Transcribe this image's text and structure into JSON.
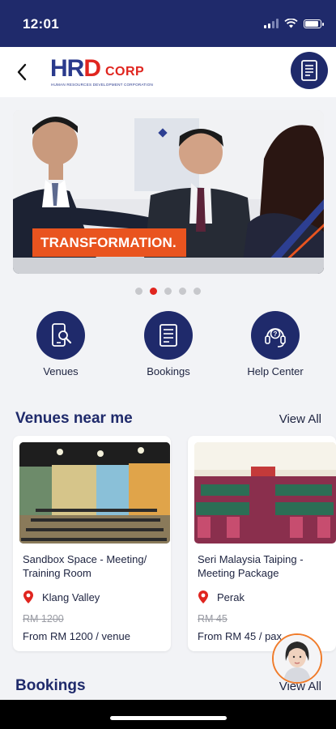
{
  "status_bar": {
    "time": "12:01"
  },
  "header": {
    "logo": {
      "text_main": "HRD",
      "text_corp": "CORP",
      "tagline": "HUMAN RESOURCES DEVELOPMENT CORPORATION"
    },
    "back_icon": "chevron-left-icon",
    "menu_icon": "document-list-icon"
  },
  "banner": {
    "caption": "TRANSFORMATION.",
    "slide_count": 5,
    "active_slide": 2
  },
  "quick_actions": [
    {
      "label": "Venues",
      "icon": "phone-search-icon"
    },
    {
      "label": "Bookings",
      "icon": "document-list-icon"
    },
    {
      "label": "Help Center",
      "icon": "headset-help-icon"
    }
  ],
  "venues_section": {
    "title": "Venues near me",
    "view_all": "View All",
    "cards": [
      {
        "name": "Sandbox Space - Meeting/ Training Room",
        "location": "Klang Valley",
        "old_price": "RM 1200",
        "price": "From RM 1200 / venue"
      },
      {
        "name": "Seri Malaysia Taiping - Meeting Package",
        "location": "Perak",
        "old_price": "RM 45",
        "price": "From RM 45 / pax"
      }
    ]
  },
  "bookings_section": {
    "title": "Bookings",
    "view_all": "View All"
  },
  "colors": {
    "primary": "#1f2a6b",
    "accent": "#e0251f",
    "caption": "#e9541f"
  }
}
